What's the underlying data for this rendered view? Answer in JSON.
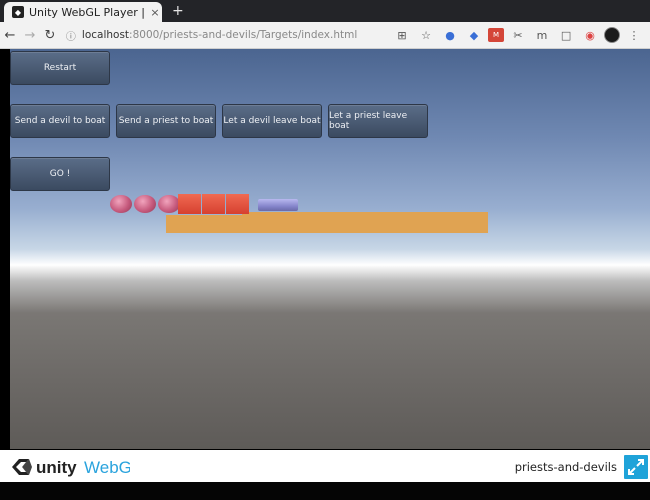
{
  "browser": {
    "tab_title": "Unity WebGL Player | pri",
    "tab_close": "×",
    "new_tab": "+",
    "url_host": "localhost",
    "url_path": ":8000/priests-and-devils/Targets/index.html",
    "nav": {
      "back": "←",
      "forward": "→",
      "reload": "↻",
      "info": "ⓘ"
    }
  },
  "game": {
    "buttons": {
      "restart": "Restart",
      "send_devil": "Send a devil to boat",
      "send_priest": "Send a priest to boat",
      "leave_devil": "Let a devil leave boat",
      "leave_priest": "Let a priest leave boat",
      "go": "GO !"
    },
    "colors": {
      "button": "#4a5b74",
      "priest": "#d07090",
      "devil": "#e64a37",
      "boat": "#9393d8",
      "shore": "#e0a352",
      "ground": "#66625e"
    }
  },
  "footer": {
    "brand_word": "unity",
    "brand_suffix": "WebGL",
    "project_name": "priests-and-devils"
  }
}
